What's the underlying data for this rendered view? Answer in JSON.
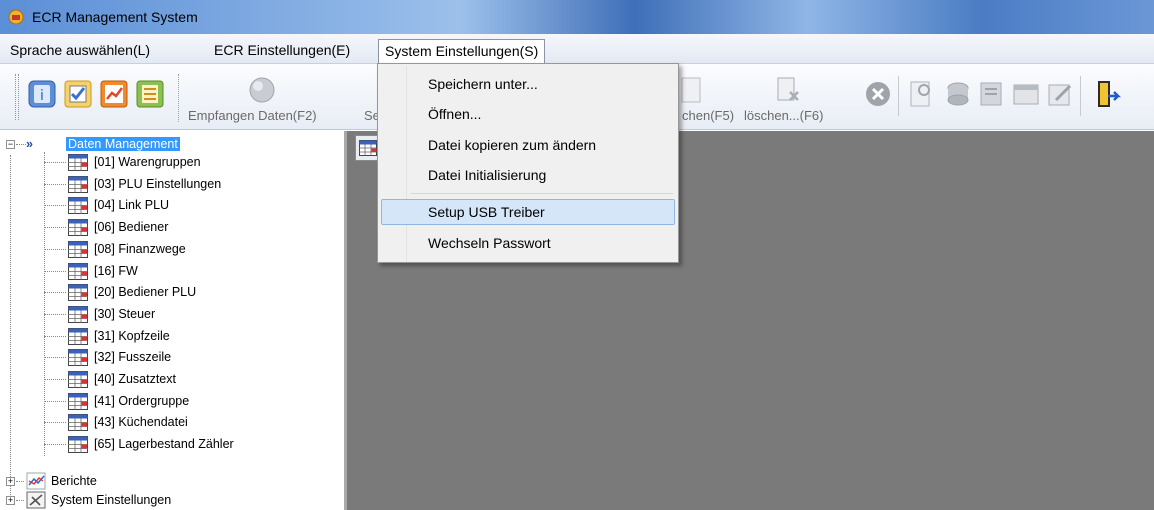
{
  "window": {
    "title": "ECR Management System"
  },
  "menubar": {
    "items": [
      "Sprache auswählen(L)",
      "ECR Einstellungen(E)",
      "System Einstellungen(S)"
    ]
  },
  "toolbar": {
    "labels": {
      "receive": "Empfangen Daten(F2)",
      "send_partial": "Se",
      "search_partial": "chen(F5)",
      "delete": "löschen...(F6)"
    }
  },
  "dropdown": {
    "items": [
      "Speichern unter...",
      "Öffnen...",
      "Datei kopieren zum ändern",
      "Datei Initialisierung",
      "Setup USB Treiber",
      "Wechseln Passwort"
    ],
    "highlighted_index": 4
  },
  "tree": {
    "root_marker": "»",
    "root": "Daten Management",
    "children": [
      "[01] Warengruppen",
      "[03] PLU Einstellungen",
      "[04] Link PLU",
      "[06] Bediener",
      "[08] Finanzwege",
      "[16] FW",
      "[20] Bediener PLU",
      "[30] Steuer",
      "[31] Kopfzeile",
      "[32] Fusszeile",
      "[40] Zusatztext",
      "[41] Ordergruppe",
      "[43] Küchendatei",
      "[65] Lagerbestand Zähler"
    ],
    "collapsed": [
      "Berichte",
      "System Einstellungen"
    ]
  },
  "colors": {
    "selection": "#3399ff",
    "menu_hover": "#d5e6f9",
    "content_bg": "#7a7a7a"
  }
}
